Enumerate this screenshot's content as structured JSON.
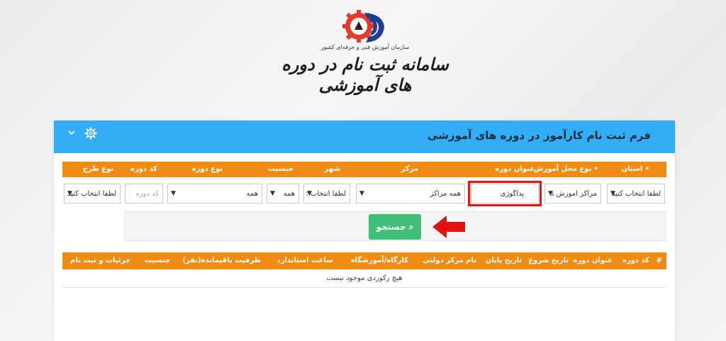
{
  "header": {
    "logo_subtitle": "سازمان آموزش فنی و حرفه‌ای کشور",
    "site_title": "سامانه ثبت نام در دوره های آموزشی"
  },
  "form": {
    "title": "فرم ثبت نام کارآموز در دوره های آموزشی",
    "filters": {
      "headers": {
        "province": "• استان",
        "training_place_type": "• نوع محل آموزش",
        "course_title": "عنوان دوره",
        "center": "مرکز",
        "city": "شهر",
        "gender": "جنسیت",
        "course_type": "نوع دوره",
        "course_code": "کد دوره",
        "plan_type": "نوع طرح"
      },
      "values": {
        "province": "لطفا انتخاب کنید",
        "training_place_type": "مراکز آموزش د",
        "course_title": "پداگوژی",
        "center": "همه مراکز",
        "city": "لطفا انتخاب :",
        "gender": "همه",
        "course_type": "همه",
        "course_code_placeholder": "کد دوره",
        "plan_type": "لطفا انتخاب کنید"
      }
    },
    "search_label": "جستجو"
  },
  "results": {
    "columns": [
      "#",
      "کد دوره",
      "عنوان دوره",
      "تاریخ شروع",
      "تاریخ پایان",
      "نام مرکز دولتی",
      "کارگاه/آموزشگاه",
      "ساعت استاندارد",
      "ظرفیت باقیمانده(نفر)",
      "جنسیت",
      "جزئیات و ثبت نام"
    ],
    "empty_message": "هیچ رکوردی موجود نیست"
  },
  "colors": {
    "header_blue": "#33adf5",
    "accent_orange": "#f08c14",
    "search_green": "#3fbe78",
    "highlight_red": "#e11111"
  },
  "icons": [
    "logo-icon",
    "gear-icon",
    "chevron-down-icon",
    "search-icon",
    "red-arrow-icon"
  ]
}
